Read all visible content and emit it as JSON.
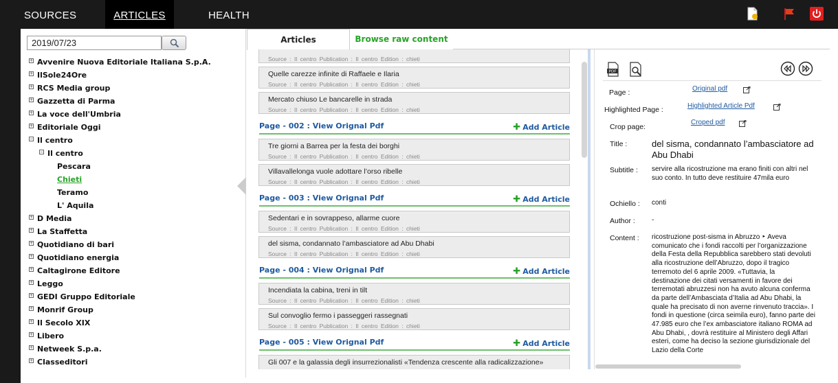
{
  "nav": {
    "sources": "SOURCES",
    "articles": "ARTICLES",
    "health": "HEALTH"
  },
  "top_icons": [
    "document-icon",
    "flag-icon",
    "power-icon"
  ],
  "search": {
    "date": "2019/07/23",
    "button_icon": "magnifier-icon"
  },
  "tree": {
    "groups_before": [
      "Avvenire Nuova Editoriale Italiana S.p.A.",
      "IlSole24Ore",
      "RCS Media group",
      "Gazzetta di Parma",
      "La voce dell'Umbria",
      "Editoriale Oggi"
    ],
    "open_group": "Il centro",
    "open_publication": "Il centro",
    "editions": [
      "Pescara",
      "Chieti",
      "Teramo",
      "L' Aquila"
    ],
    "selected_edition": "Chieti",
    "groups_after": [
      "D Media",
      "La Staffetta",
      "Quotidiano di bari",
      "Quotidiano energia",
      "Caltagirone Editore",
      "Leggo",
      "GEDI Gruppo Editoriale",
      "Monrif Group",
      "Il Secolo XIX",
      "Libero",
      "Netweek S.p.a.",
      "Classeditori"
    ]
  },
  "tabs": {
    "articles": "Articles",
    "raw": "Browse raw content"
  },
  "meta_line": "Source : Il centro   Publication : Il centro   Edition : chieti",
  "add_article": "Add Article",
  "list": [
    {
      "type": "meta_only"
    },
    {
      "type": "article",
      "title": "Quelle carezze infinite di Raffaele e Ilaria"
    },
    {
      "type": "article",
      "title": "Mercato chiuso Le bancarelle in strada"
    },
    {
      "type": "page",
      "label": "Page - 002 : View Orignal Pdf"
    },
    {
      "type": "article",
      "title": "Tre giorni a Barrea per la festa dei borghi"
    },
    {
      "type": "article",
      "title": "Villavallelonga vuole adottare l’orso ribelle"
    },
    {
      "type": "page",
      "label": "Page - 003 : View Orignal Pdf"
    },
    {
      "type": "article",
      "title": "Sedentari e in sovrappeso, allarme cuore"
    },
    {
      "type": "article",
      "title": "del sisma, condannato l’ambasciatore ad Abu Dhabi"
    },
    {
      "type": "page",
      "label": "Page - 004 : View Orignal Pdf"
    },
    {
      "type": "article",
      "title": "Incendiata la cabina, treni in tilt"
    },
    {
      "type": "article",
      "title": "Sul convoglio fermo i passeggeri rassegnati"
    },
    {
      "type": "page",
      "label": "Page - 005 : View Orignal Pdf"
    },
    {
      "type": "article",
      "title": "Gli 007 e la galassia degli insurrezionalisti «Tendenza crescente alla radicalizzazione»"
    }
  ],
  "detail": {
    "page_label": "Page :",
    "page_link": "Original pdf",
    "highlighted_label": "Highlighted Page :",
    "highlighted_link": "Highlighted Article Pdf",
    "crop_label": "Crop page:",
    "crop_link": "Croped pdf",
    "title_label": "Title :",
    "title": "del sisma, condannato l’ambasciatore ad Abu Dhabi",
    "subtitle_label": "Subtitle :",
    "subtitle": "servire alla ricostruzione ma erano finiti con altri nel suo conto. In tutto deve restituire 47mila euro",
    "occhiello_label": "Ochiello :",
    "occhiello": "conti",
    "author_label": "Author :",
    "author": "-",
    "content_label": "Content :",
    "content": "ricostruzione post-sisma in Abruzzo ‣ Aveva comunicato che i fondi raccolti per l’organizzazione della Festa della Repubblica sarebbero stati devoluti alla ricostruzione dell’Abruzzo, dopo il tragico terremoto del 6 aprile 2009. «Tuttavia, la destinazione dei citati versamenti in favore dei terremotati abruzzesi non ha avuto alcuna conferma da parte dell’Ambasciata d’Italia ad Abu Dhabi, la quale ha precisato di non averne rinvenuto traccia». I fondi in questione (circa seimila euro), fanno parte dei 47.985 euro che l’ex ambasciatore italiano ROMA ad Abu Dhabi, , dovrà restituire al Ministero degli Affari esteri, come ha deciso la sezione giurisdizionale del Lazio della Corte"
  },
  "colors": {
    "topbar": "#1a1a1a",
    "accent_green": "#27a327",
    "link_blue": "#1e5aa0",
    "page_rule": "#6cbf6c",
    "power_red": "#e02020"
  }
}
